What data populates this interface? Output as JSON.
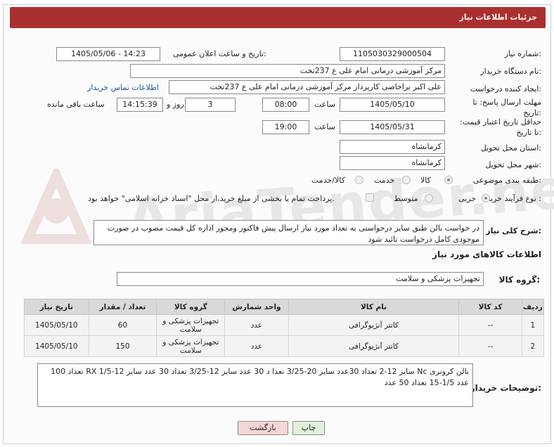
{
  "header": {
    "title": "جزئیات اطلاعات نیاز"
  },
  "labels": {
    "need_number": "شماره نیاز:",
    "announce_datetime": "تاریخ و ساعت اعلان عمومی:",
    "buyer_org": "نام دستگاه خریدار:",
    "requester": "ایجاد کننده درخواست:",
    "deadline": "مهلت ارسال پاسخ: تا تاریخ:",
    "validity": "حداقل تاریخ اعتبار قیمت: تا تاریخ:",
    "province": "استان محل تحویل:",
    "city": "شهر محل تحویل:",
    "category": "طبقه بندی موضوعی:",
    "process_type": "نوع فرآیند خرید :",
    "time_label": "ساعت",
    "days_and": "روز و",
    "remaining": "ساعت باقی مانده"
  },
  "values": {
    "need_number": "1105030329000504",
    "announce_datetime": "1405/05/06 - 14:23",
    "buyer_org": "مرکز آموزشی درمانی امام علی ع 237تخت",
    "requester": "علی اکبر براخاصی کارپرداز  مرکز آموزشی درمانی امام علی ع 237تخت",
    "contact_link": "اطلاعات تماس خریدار",
    "deadline_date": "1405/05/10",
    "deadline_time": "08:00",
    "days": "3",
    "remaining_time": "14:15:39",
    "validity_date": "1405/05/31",
    "validity_time": "19:00",
    "province": "کرمانشاه",
    "city": "کرمانشاه"
  },
  "category_options": [
    "کالا",
    "خدمت",
    "کالا/خدمت"
  ],
  "process_options": [
    "جزیی",
    "متوسط"
  ],
  "payment_note": "پرداخت تمام یا بخشی از مبلغ خرید،از محل \"اسناد خزانه اسلامی\" خواهد بود.",
  "description": {
    "label": "شرح کلی نیاز:",
    "text": "در خواست بالن طبق سایز درخواستی به تعداد مورد نیاز ارسال پیش فاکتور ومجوز اداره کل قیمت مصوب  در صورت موجودی کامل درخواست تائید شود"
  },
  "goods_section": {
    "title": "اطلاعات کالاهای مورد نیاز",
    "group_label": "گروه کالا:",
    "group_value": "تجهیزات پزشکی و سلامت"
  },
  "table": {
    "headers": [
      "ردیف",
      "کد کالا",
      "نام کالا",
      "واحد شمارش",
      "گروه کالا",
      "تعداد / مقدار",
      "تاریخ نیاز"
    ],
    "rows": [
      {
        "row": "1",
        "code": "--",
        "name": "کاتتر آنژیوگرافی",
        "unit": "عدد",
        "group": "تجهیزات پزشکی و سلامت",
        "qty": "60",
        "date": "1405/05/10"
      },
      {
        "row": "2",
        "code": "--",
        "name": "کاتتر آنژیوگرافی",
        "unit": "عدد",
        "group": "تجهیزات پزشکی و سلامت",
        "qty": "150",
        "date": "1405/05/10"
      }
    ]
  },
  "buyer_notes": {
    "label": "توضیحات خریدار:",
    "text": "بالن کرونری Nc سایز 12-2 تعداد 30عدد سایز 20-3/25 تعدا د 30 عدد  سایز 12-3/25 تعداد 30 عدد سایز RX 1/5-12 تعداد 100 عدد  1/5-15 تعداد 50 عدد"
  },
  "buttons": {
    "print": "چاپ",
    "back": "بازگشت"
  },
  "watermark": "AriaTender.net",
  "colors": {
    "header": "#a9302f",
    "link": "#1a55a0",
    "back_button": "#f6d6d6",
    "print_button": "#dff2d9"
  }
}
